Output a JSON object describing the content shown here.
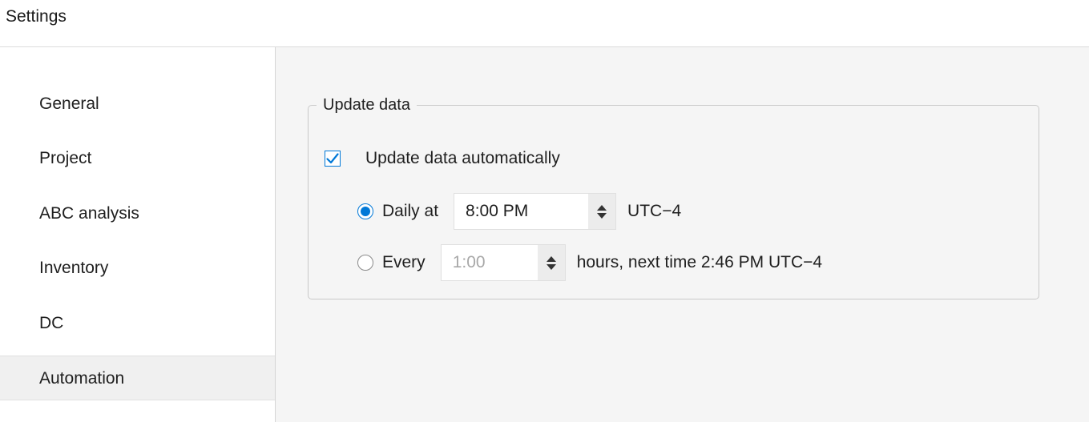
{
  "window": {
    "title": "Settings"
  },
  "sidebar": {
    "items": [
      {
        "label": "General",
        "selected": false
      },
      {
        "label": "Project",
        "selected": false
      },
      {
        "label": "ABC analysis",
        "selected": false
      },
      {
        "label": "Inventory",
        "selected": false
      },
      {
        "label": "DC",
        "selected": false
      },
      {
        "label": "Automation",
        "selected": true
      }
    ]
  },
  "update_group": {
    "legend": "Update data",
    "auto_update": {
      "label": "Update data automatically",
      "checked": true
    },
    "daily": {
      "label": "Daily at",
      "selected": true,
      "time_value": "8:00 PM",
      "suffix": "UTC−4"
    },
    "every": {
      "label": "Every",
      "selected": false,
      "interval_value": "1:00",
      "suffix": "hours, next time 2:46 PM UTC−4"
    }
  },
  "colors": {
    "accent": "#0078d7",
    "content_bg": "#f5f5f5",
    "selected_item_bg": "#f0f0f0",
    "disabled_text": "#a8a8a8"
  }
}
